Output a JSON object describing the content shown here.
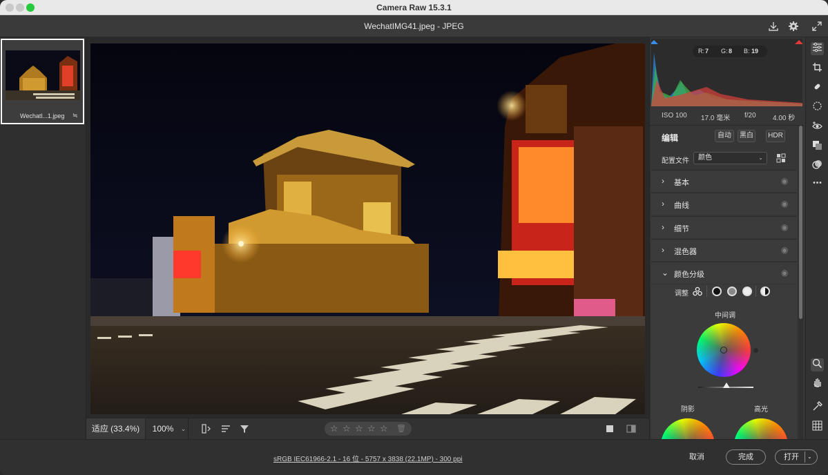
{
  "window": {
    "title": "Camera Raw 15.3.1"
  },
  "file": {
    "title": "WechatIMG41.jpeg -  JPEG"
  },
  "filmstrip": {
    "items": [
      {
        "label": "Wechatl...1.jpeg"
      }
    ]
  },
  "histogram": {
    "r_label": "R:",
    "r": "7",
    "g_label": "G:",
    "g": "8",
    "b_label": "B:",
    "b": "19"
  },
  "camera_info": {
    "iso": "ISO 100",
    "focal": "17.0 毫米",
    "aperture": "f/20",
    "shutter": "4.00 秒"
  },
  "edit": {
    "title": "编辑",
    "auto": "自动",
    "bw": "黑白",
    "hdr": "HDR",
    "profile_label": "配置文件",
    "profile_value": "颜色"
  },
  "sections": [
    {
      "label": "基本",
      "expanded": false
    },
    {
      "label": "曲线",
      "expanded": false
    },
    {
      "label": "细节",
      "expanded": false
    },
    {
      "label": "混色器",
      "expanded": false
    },
    {
      "label": "颜色分级",
      "expanded": true
    }
  ],
  "color_grading": {
    "adjust_label": "调整",
    "midtones_label": "中间调",
    "shadows_label": "阴影",
    "highlights_label": "高光"
  },
  "bottom_toolbar": {
    "zoom_fit": "适应 (33.4%)",
    "zoom_100": "100%",
    "rating_stars": 0,
    "rating_max": 5
  },
  "footer": {
    "info": "sRGB IEC61966-2.1 - 16 位 - 5757 x 3838 (22.1MP) - 300 ppi",
    "cancel": "取消",
    "done": "完成",
    "open": "打开"
  },
  "icons": {
    "header": [
      "save-icon",
      "settings-icon",
      "fullscreen-icon"
    ],
    "tools": [
      "edit-icon",
      "crop-icon",
      "heal-icon",
      "mask-icon",
      "redeye-icon",
      "snapshots-icon",
      "presets-icon",
      "more-icon",
      "zoom-icon",
      "hand-icon",
      "color-sampler-icon",
      "grid-icon"
    ]
  }
}
